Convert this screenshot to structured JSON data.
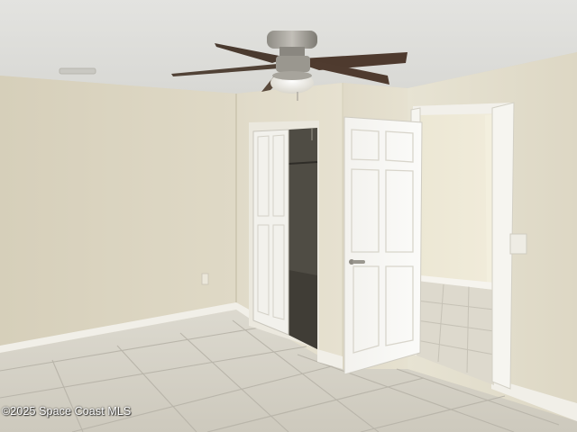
{
  "photo": {
    "watermark": "©2025 Space Coast MLS"
  }
}
